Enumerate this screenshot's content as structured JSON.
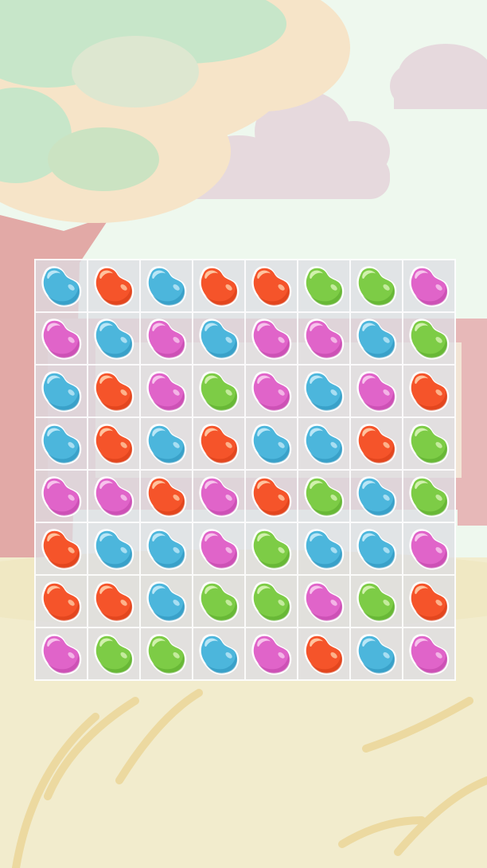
{
  "colors": {
    "sky": "#eef8ee",
    "cloud": "#e6d9dd",
    "foliage_green": "#c7e6c9",
    "foliage_peach": "#f6e4c8",
    "trunk": "#e2a9a6",
    "fence": "#e7b8b8",
    "ground": "#f2eccd",
    "grass": "#ecdca8",
    "board_bg": "#dcdce2"
  },
  "bean_colors": {
    "blue": {
      "base": "#4cb6dc",
      "dark": "#2a8fba",
      "light": "#bfe9f7"
    },
    "orange": {
      "base": "#f5542a",
      "dark": "#d33b14",
      "light": "#ffc9a4"
    },
    "pink": {
      "base": "#e064c9",
      "dark": "#bd41a6",
      "light": "#f8c8ee"
    },
    "green": {
      "base": "#7dcc46",
      "dark": "#58a82a",
      "light": "#d6f2b3"
    }
  },
  "grid": [
    [
      "blue",
      "orange",
      "blue",
      "orange",
      "orange",
      "green",
      "green",
      "pink"
    ],
    [
      "pink",
      "blue",
      "pink",
      "blue",
      "pink",
      "pink",
      "blue",
      "green"
    ],
    [
      "blue",
      "orange",
      "pink",
      "green",
      "pink",
      "blue",
      "pink",
      "orange"
    ],
    [
      "blue",
      "orange",
      "blue",
      "orange",
      "blue",
      "blue",
      "orange",
      "green"
    ],
    [
      "pink",
      "pink",
      "orange",
      "pink",
      "orange",
      "green",
      "blue",
      "green"
    ],
    [
      "orange",
      "blue",
      "blue",
      "pink",
      "green",
      "blue",
      "blue",
      "pink"
    ],
    [
      "orange",
      "orange",
      "blue",
      "green",
      "green",
      "pink",
      "green",
      "orange"
    ],
    [
      "pink",
      "green",
      "green",
      "blue",
      "pink",
      "orange",
      "blue",
      "pink"
    ]
  ]
}
